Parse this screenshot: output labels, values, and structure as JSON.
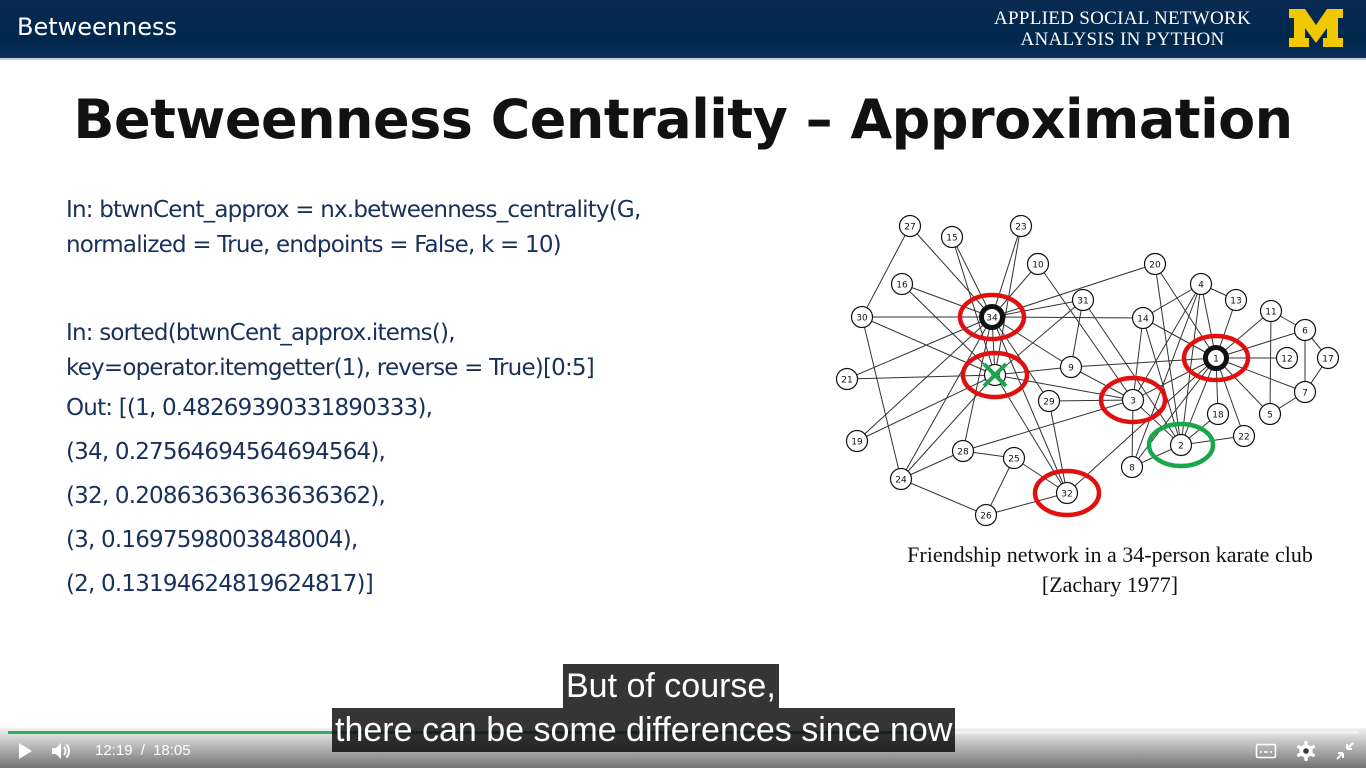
{
  "header": {
    "section_title": "Betweenness",
    "course_line1": "APPLIED SOCIAL NETWORK",
    "course_line2": "ANALYSIS IN PYTHON",
    "logo_letter": "M",
    "logo_color": "#f2c800"
  },
  "slide": {
    "title": "Betweenness Centrality – Approximation",
    "code_block_1": [
      "In: btwnCent_approx = nx.betweenness_centrality(G,",
      "normalized = True, endpoints = False, k = 10)"
    ],
    "code_block_2": [
      "In: sorted(btwnCent_approx.items(),",
      "key=operator.itemgetter(1), reverse = True)[0:5]"
    ],
    "output_lines": [
      "Out: [(1, 0.48269390331890333),",
      "(34, 0.27564694564694564),",
      "(32, 0.20863636363636362),",
      "(3, 0.1697598003848004),",
      "(2, 0.13194624819624817)]"
    ],
    "code_color": "#18305a",
    "caption_line1": "Friendship network in a 34-person karate club",
    "caption_line2": "[Zachary 1977]"
  },
  "network": {
    "nodes": [
      {
        "id": "27"
      },
      {
        "id": "15"
      },
      {
        "id": "23"
      },
      {
        "id": "10"
      },
      {
        "id": "20"
      },
      {
        "id": "16"
      },
      {
        "id": "34"
      },
      {
        "id": "31"
      },
      {
        "id": "14"
      },
      {
        "id": "4"
      },
      {
        "id": "13"
      },
      {
        "id": "11"
      },
      {
        "id": "6"
      },
      {
        "id": "30"
      },
      {
        "id": "33"
      },
      {
        "id": "9"
      },
      {
        "id": "1"
      },
      {
        "id": "12"
      },
      {
        "id": "17"
      },
      {
        "id": "21"
      },
      {
        "id": "29"
      },
      {
        "id": "3"
      },
      {
        "id": "7"
      },
      {
        "id": "18"
      },
      {
        "id": "5"
      },
      {
        "id": "19"
      },
      {
        "id": "28"
      },
      {
        "id": "2"
      },
      {
        "id": "22"
      },
      {
        "id": "25"
      },
      {
        "id": "8"
      },
      {
        "id": "24"
      },
      {
        "id": "32"
      },
      {
        "id": "26"
      }
    ],
    "bold_nodes": [
      "34",
      "1"
    ],
    "red_circled": [
      "34",
      "33",
      "1",
      "3",
      "32"
    ],
    "green_circled": [
      "2"
    ],
    "crossed_out": [
      "33"
    ],
    "highlight_red": "#e01010",
    "highlight_green": "#1aa64a",
    "edges": [
      [
        "1",
        "2"
      ],
      [
        "1",
        "3"
      ],
      [
        "1",
        "4"
      ],
      [
        "1",
        "5"
      ],
      [
        "1",
        "6"
      ],
      [
        "1",
        "7"
      ],
      [
        "1",
        "8"
      ],
      [
        "1",
        "9"
      ],
      [
        "1",
        "11"
      ],
      [
        "1",
        "12"
      ],
      [
        "1",
        "13"
      ],
      [
        "1",
        "14"
      ],
      [
        "1",
        "18"
      ],
      [
        "1",
        "20"
      ],
      [
        "1",
        "22"
      ],
      [
        "1",
        "32"
      ],
      [
        "2",
        "3"
      ],
      [
        "2",
        "4"
      ],
      [
        "2",
        "8"
      ],
      [
        "2",
        "14"
      ],
      [
        "2",
        "18"
      ],
      [
        "2",
        "20"
      ],
      [
        "2",
        "22"
      ],
      [
        "2",
        "31"
      ],
      [
        "3",
        "4"
      ],
      [
        "3",
        "8"
      ],
      [
        "3",
        "9"
      ],
      [
        "3",
        "10"
      ],
      [
        "3",
        "14"
      ],
      [
        "3",
        "28"
      ],
      [
        "3",
        "29"
      ],
      [
        "3",
        "33"
      ],
      [
        "4",
        "8"
      ],
      [
        "4",
        "13"
      ],
      [
        "4",
        "14"
      ],
      [
        "5",
        "7"
      ],
      [
        "5",
        "11"
      ],
      [
        "6",
        "7"
      ],
      [
        "6",
        "11"
      ],
      [
        "6",
        "17"
      ],
      [
        "7",
        "17"
      ],
      [
        "9",
        "31"
      ],
      [
        "9",
        "33"
      ],
      [
        "9",
        "34"
      ],
      [
        "10",
        "34"
      ],
      [
        "14",
        "34"
      ],
      [
        "15",
        "33"
      ],
      [
        "15",
        "34"
      ],
      [
        "16",
        "33"
      ],
      [
        "16",
        "34"
      ],
      [
        "19",
        "33"
      ],
      [
        "19",
        "34"
      ],
      [
        "20",
        "34"
      ],
      [
        "21",
        "33"
      ],
      [
        "21",
        "34"
      ],
      [
        "23",
        "33"
      ],
      [
        "23",
        "34"
      ],
      [
        "24",
        "26"
      ],
      [
        "24",
        "28"
      ],
      [
        "24",
        "30"
      ],
      [
        "24",
        "33"
      ],
      [
        "24",
        "34"
      ],
      [
        "25",
        "26"
      ],
      [
        "25",
        "28"
      ],
      [
        "25",
        "32"
      ],
      [
        "26",
        "32"
      ],
      [
        "27",
        "30"
      ],
      [
        "27",
        "34"
      ],
      [
        "28",
        "34"
      ],
      [
        "29",
        "32"
      ],
      [
        "29",
        "34"
      ],
      [
        "30",
        "33"
      ],
      [
        "30",
        "34"
      ],
      [
        "31",
        "33"
      ],
      [
        "31",
        "34"
      ],
      [
        "32",
        "33"
      ],
      [
        "32",
        "34"
      ],
      [
        "33",
        "34"
      ]
    ]
  },
  "player": {
    "subtitle_line1": "But of course,",
    "subtitle_line2": "there can be some differences since now",
    "current_time": "12:19",
    "separator": "/",
    "duration": "18:05",
    "progress": 0.681,
    "progress_color": "#2bb35a"
  }
}
